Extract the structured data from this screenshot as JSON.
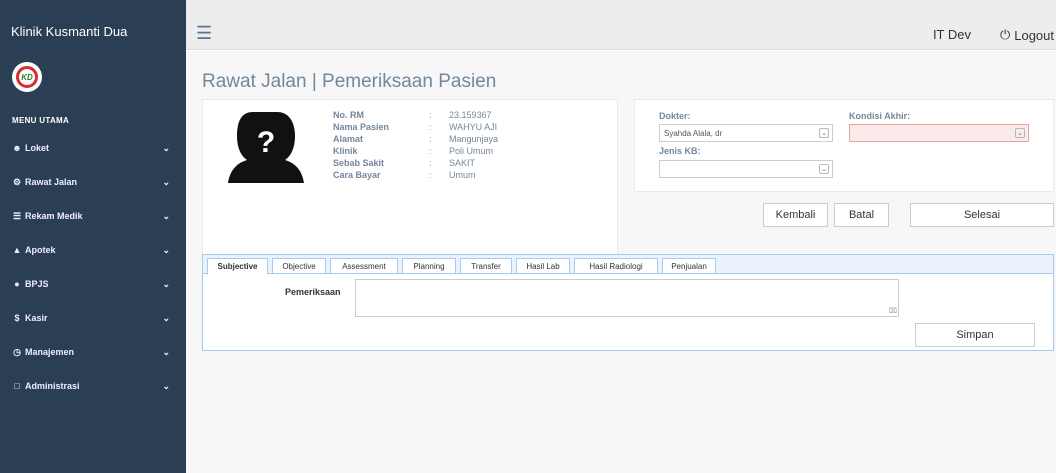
{
  "app": {
    "brand": "Klinik Kusmanti Dua",
    "logo_text": "KD"
  },
  "sidebar": {
    "menu_title": "MENU UTAMA",
    "items": [
      {
        "label": "Loket",
        "icon": "user-icon",
        "glyph": "☻"
      },
      {
        "label": "Rawat Jalan",
        "icon": "gear-icon",
        "glyph": "⚙"
      },
      {
        "label": "Rekam Medik",
        "icon": "list-icon",
        "glyph": "☰"
      },
      {
        "label": "Apotek",
        "icon": "beaker-icon",
        "glyph": "▲"
      },
      {
        "label": "BPJS",
        "icon": "bulb-icon",
        "glyph": "●"
      },
      {
        "label": "Kasir",
        "icon": "dollar-icon",
        "glyph": "$"
      },
      {
        "label": "Manajemen",
        "icon": "clock-icon",
        "glyph": "◷"
      },
      {
        "label": "Administrasi",
        "icon": "square-icon",
        "glyph": "□"
      }
    ]
  },
  "topbar": {
    "user": "IT Dev",
    "logout": "Logout"
  },
  "page": {
    "title": "Rawat Jalan | Pemeriksaan Pasien"
  },
  "patient": {
    "rows": [
      {
        "key": "No. RM",
        "sep": ":",
        "value": "23.159367"
      },
      {
        "key": "Nama Pasien",
        "sep": ":",
        "value": "WAHYU AJI"
      },
      {
        "key": "Alamat",
        "sep": ":",
        "value": "Mangunjaya"
      },
      {
        "key": "Klinik",
        "sep": ":",
        "value": "Poli Umum"
      },
      {
        "key": "Sebab Sakit",
        "sep": ":",
        "value": "SAKIT"
      },
      {
        "key": "Cara Bayar",
        "sep": ":",
        "value": "Umum"
      }
    ]
  },
  "doctor_form": {
    "dokter_label": "Dokter:",
    "dokter_value": "Syahda Alala, dr",
    "kondisi_label": "Kondisi Akhir:",
    "kondisi_value": "",
    "jenis_kb_label": "Jenis KB:",
    "jenis_kb_value": ""
  },
  "actions": {
    "kembali": "Kembali",
    "batal": "Batal",
    "selesai": "Selesai"
  },
  "tabs": [
    {
      "label": "Subjective",
      "active": true
    },
    {
      "label": "Objective"
    },
    {
      "label": "Assessment"
    },
    {
      "label": "Planning"
    },
    {
      "label": "Transfer"
    },
    {
      "label": "Hasil Lab"
    },
    {
      "label": "Hasil Radiologi"
    },
    {
      "label": "Penjualan"
    }
  ],
  "subjective_form": {
    "label": "Pemeriksaan",
    "value": "",
    "save": "Simpan"
  },
  "colors": {
    "sidebar": "#2a3f54",
    "tab_border": "#a9c9f0",
    "pink_select": "#fbeaea"
  }
}
